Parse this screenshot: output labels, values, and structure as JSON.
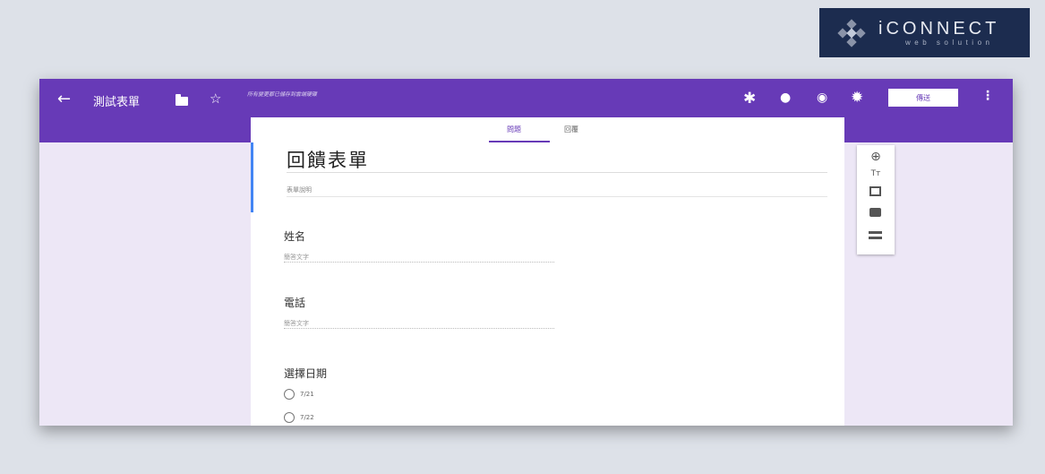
{
  "logo": {
    "main": "iCONNECT",
    "sub": "web solution"
  },
  "header": {
    "form_title": "測試表單",
    "save_status": "所有變更都已儲存到雲端硬碟",
    "send_label": "傳送",
    "accent_color": "#673ab7"
  },
  "icons": {
    "back": "←",
    "star": "☆",
    "addon": "✱",
    "palette": "●",
    "preview": "◉",
    "settings": "✹",
    "more": "⋮",
    "add_question": "⊕",
    "add_title": "Tт"
  },
  "tabs": {
    "questions": "問題",
    "responses": "回覆"
  },
  "form": {
    "heading": "回饋表單",
    "description_placeholder": "表單說明",
    "questions": [
      {
        "label": "姓名",
        "answer_placeholder": "簡答文字"
      },
      {
        "label": "電話",
        "answer_placeholder": "簡答文字"
      },
      {
        "label": "選擇日期",
        "options": [
          "7/21",
          "7/22"
        ]
      }
    ]
  }
}
